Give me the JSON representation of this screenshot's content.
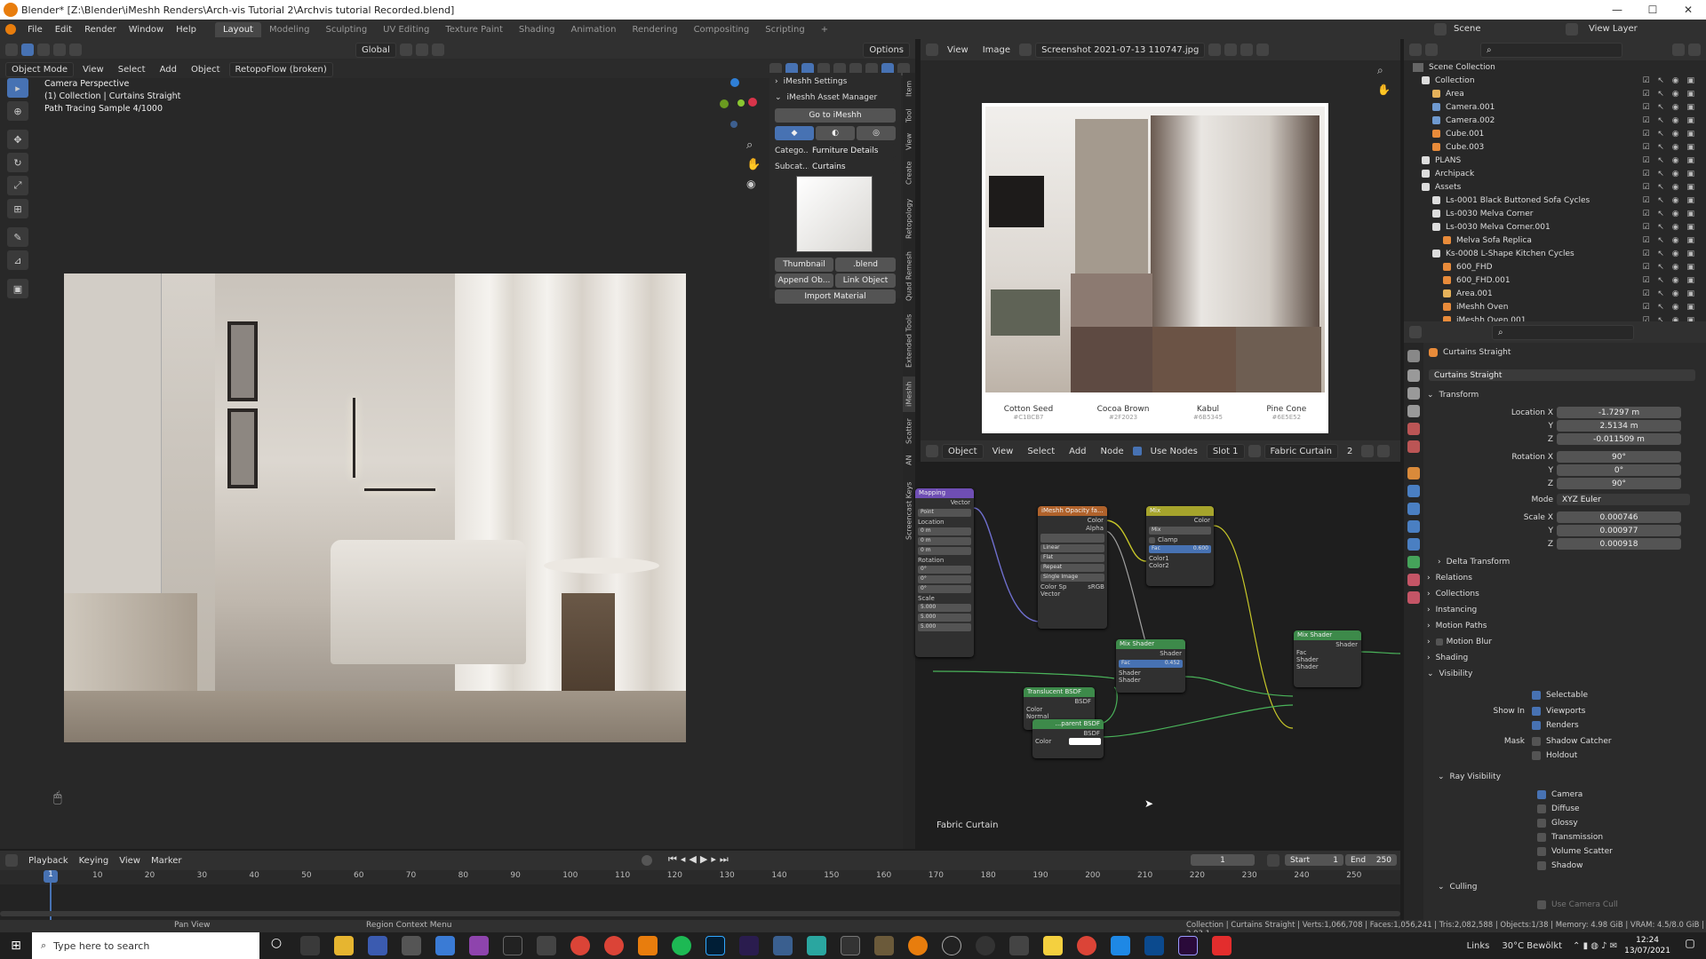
{
  "window": {
    "title": "Blender* [Z:\\Blender\\iMeshh Renders\\Arch-vis Tutorial 2\\Archvis tutorial Recorded.blend]",
    "min": "—",
    "max": "☐",
    "close": "✕"
  },
  "menu": {
    "items": [
      "File",
      "Edit",
      "Render",
      "Window",
      "Help"
    ],
    "workspaces": [
      "Layout",
      "Modeling",
      "Sculpting",
      "UV Editing",
      "Texture Paint",
      "Shading",
      "Animation",
      "Rendering",
      "Compositing",
      "Scripting",
      "+"
    ],
    "scene": "Scene",
    "view_layer": "View Layer"
  },
  "viewport": {
    "header": {
      "mode": "Object Mode",
      "view": "View",
      "select": "Select",
      "add": "Add",
      "object": "Object",
      "retopo": "RetopoFlow (broken)",
      "orientation": "Global",
      "options": "Options"
    },
    "overlay": {
      "line1": "Camera Perspective",
      "line2": "(1) Collection | Curtains Straight",
      "line3": "Path Tracing Sample 4/1000"
    }
  },
  "npanel": {
    "settings": "iMeshh Settings",
    "asset_manager": "iMeshh Asset Manager",
    "go_to": "Go to iMeshh",
    "category_label": "Catego...",
    "category_value": "Furniture Details",
    "subcat_label": "Subcat...",
    "subcat_value": "Curtains",
    "thumbnail": "Thumbnail",
    "blend": ".blend",
    "append": "Append Ob...",
    "link": "Link Object",
    "import_material": "Import Material",
    "tabs": [
      "Item",
      "Tool",
      "View",
      "Create",
      "Retopology",
      "Quad Remesh",
      "Extended Tools",
      "iMeshh",
      "Scatter",
      "AN",
      "Screencast Keys"
    ]
  },
  "image_editor": {
    "view": "View",
    "image": "Image",
    "filename": "Screenshot 2021-07-13 110747.jpg"
  },
  "moodboard": {
    "swatches": [
      {
        "name": "Cotton Seed",
        "code": "#C1BCB7",
        "color": "#c1bcb7"
      },
      {
        "name": "Cocoa Brown",
        "code": "#2F2023",
        "color": "#5e4a42"
      },
      {
        "name": "Kabul",
        "code": "#6B5345",
        "color": "#6b5345"
      },
      {
        "name": "Pine Cone",
        "code": "#6E5E52",
        "color": "#6e5e52"
      }
    ],
    "sage": "#5f6356",
    "taupe": "#8c7a71"
  },
  "node_editor": {
    "header": {
      "object": "Object",
      "view": "View",
      "select": "Select",
      "add": "Add",
      "node": "Node",
      "use_nodes": "Use Nodes",
      "slot": "Slot 1",
      "material": "Fabric Curtain",
      "users": "2"
    },
    "label": "Fabric Curtain",
    "nodes": {
      "mapping": {
        "title": "Mapping",
        "out": "Vector",
        "type": "Point",
        "loc": "Location",
        "rot": "Rotation",
        "scale": "Scale",
        "x": "X",
        "y": "Y",
        "z": "Z",
        "loc_x": "0 m",
        "loc_y": "0 m",
        "loc_z": "0 m",
        "rot_x": "0°",
        "rot_y": "0°",
        "rot_z": "0°",
        "sc_x": "5.000",
        "sc_y": "5.000",
        "sc_z": "5.000"
      },
      "opacity": {
        "title": "iMeshh Opacity fa...",
        "color": "Color",
        "alpha": "Alpha",
        "interp": "Linear",
        "proj": "Flat",
        "ext": "Repeat",
        "src": "Single Image",
        "colorspace": "Color Sp",
        "srgb": "sRGB",
        "vector": "Vector"
      },
      "mix": {
        "title": "Mix",
        "color": "Color",
        "blend": "Mix",
        "clamp": "Clamp",
        "fac": "Fac",
        "fac_val": "0.600",
        "color1": "Color1",
        "color2": "Color2"
      },
      "mixshader1": {
        "title": "Mix Shader",
        "shader": "Shader",
        "fac": "Fac",
        "fac_val": "0.452"
      },
      "mixshader2": {
        "title": "Mix Shader",
        "shader": "Shader",
        "fac": "Fac"
      },
      "translucent": {
        "title": "Translucent BSDF",
        "bsdf": "BSDF",
        "color": "Color",
        "normal": "Normal"
      },
      "transparent": {
        "title": "...parent BSDF",
        "bsdf": "BSDF",
        "color": "Color"
      }
    }
  },
  "outliner": {
    "title": "Scene Collection",
    "rows": [
      {
        "name": "Collection",
        "indent": 1,
        "type": "coll"
      },
      {
        "name": "Area",
        "indent": 2,
        "type": "light"
      },
      {
        "name": "Camera.001",
        "indent": 2,
        "type": "cam"
      },
      {
        "name": "Camera.002",
        "indent": 2,
        "type": "cam"
      },
      {
        "name": "Cube.001",
        "indent": 2,
        "type": "mesh"
      },
      {
        "name": "Cube.003",
        "indent": 2,
        "type": "mesh"
      },
      {
        "name": "PLANS",
        "indent": 1,
        "type": "coll"
      },
      {
        "name": "Archipack",
        "indent": 1,
        "type": "coll"
      },
      {
        "name": "Assets",
        "indent": 1,
        "type": "coll"
      },
      {
        "name": "Ls-0001 Black Buttoned Sofa Cycles",
        "indent": 2,
        "type": "coll"
      },
      {
        "name": "Ls-0030 Melva Corner",
        "indent": 2,
        "type": "coll"
      },
      {
        "name": "Ls-0030 Melva Corner.001",
        "indent": 2,
        "type": "coll"
      },
      {
        "name": "Melva Sofa Replica",
        "indent": 3,
        "type": "mesh"
      },
      {
        "name": "Ks-0008 L-Shape Kitchen Cycles",
        "indent": 2,
        "type": "coll"
      },
      {
        "name": "600_FHD",
        "indent": 3,
        "type": "mesh"
      },
      {
        "name": "600_FHD.001",
        "indent": 3,
        "type": "mesh"
      },
      {
        "name": "Area.001",
        "indent": 3,
        "type": "light"
      },
      {
        "name": "iMeshh Oven",
        "indent": 3,
        "type": "mesh"
      },
      {
        "name": "iMeshh Oven.001",
        "indent": 3,
        "type": "mesh"
      }
    ]
  },
  "properties": {
    "object_name": "Curtains Straight",
    "data_name": "Curtains Straight",
    "transform": "Transform",
    "location": "Location",
    "rotation": "Rotation",
    "scale": "Scale",
    "mode_label": "Mode",
    "mode": "XYZ Euler",
    "x": "X",
    "y": "Y",
    "z": "Z",
    "loc_x": "-1.7297 m",
    "loc_y": "2.5134 m",
    "loc_z": "-0.011509 m",
    "rot_x": "90°",
    "rot_y": "0°",
    "rot_z": "90°",
    "sc_x": "0.000746",
    "sc_y": "0.000977",
    "sc_z": "0.000918",
    "sections": [
      "Delta Transform",
      "Relations",
      "Collections",
      "Instancing",
      "Motion Paths",
      "Motion Blur",
      "Shading",
      "Visibility"
    ],
    "selectable": "Selectable",
    "show_in": "Show In",
    "viewports": "Viewports",
    "renders": "Renders",
    "mask": "Mask",
    "shadow_catcher": "Shadow Catcher",
    "holdout": "Holdout",
    "ray_visibility": "Ray Visibility",
    "camera": "Camera",
    "diffuse": "Diffuse",
    "glossy": "Glossy",
    "transmission": "Transmission",
    "volume_scatter": "Volume Scatter",
    "shadow": "Shadow",
    "culling": "Culling",
    "use_camera_cull": "Use Camera Cull"
  },
  "timeline": {
    "playback": "Playback",
    "keying": "Keying",
    "view": "View",
    "marker": "Marker",
    "current": "1",
    "start_label": "Start",
    "start": "1",
    "end_label": "End",
    "end": "250",
    "ticks": [
      "10",
      "20",
      "30",
      "40",
      "50",
      "60",
      "70",
      "80",
      "90",
      "100",
      "110",
      "120",
      "130",
      "140",
      "150",
      "160",
      "170",
      "180",
      "190",
      "200",
      "210",
      "220",
      "230",
      "240",
      "250"
    ]
  },
  "status": {
    "pan": "Pan View",
    "context": "Region Context Menu",
    "info": "Collection | Curtains Straight | Verts:1,066,708 | Faces:1,056,241 | Tris:2,082,588 | Objects:1/38 | Memory: 4.98 GiB | VRAM: 4.5/8.0 GiB | 2.93.1"
  },
  "taskbar": {
    "search": "Type here to search",
    "links": "Links",
    "weather": "30°C  Bewölkt",
    "time": "12:24",
    "date": "13/07/2021"
  }
}
